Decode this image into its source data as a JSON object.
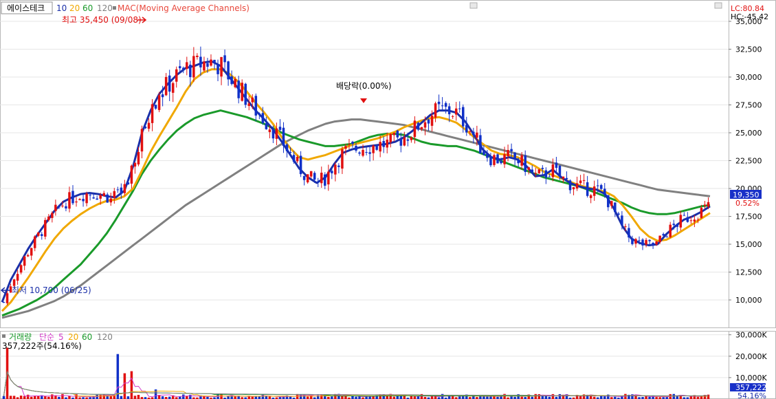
{
  "header": {
    "stock_name": "에이스테크",
    "ma_periods": [
      "10",
      "20",
      "60",
      "120"
    ],
    "indicator_label": "MAC(Moving Average Channels)",
    "indicator_color": "#e8483c",
    "lc_label": "LC:80.84",
    "hc_label": "HC:-45.42"
  },
  "volume_header": {
    "title": "거래량",
    "ma_label": "단순",
    "ma_periods": [
      "5",
      "20",
      "60",
      "120"
    ],
    "current_value": "357,222주(54.16%)"
  },
  "colors": {
    "up": "#e11010",
    "down": "#1030c8",
    "ma10": "#1a2fa8",
    "ma20": "#f0a800",
    "ma60": "#1a9a2a",
    "ma120": "#808080",
    "price_tag": "#1830c8",
    "pct_text": "#e11010",
    "vol_ma5": "#d23cc8",
    "vol_ma20": "#f0a800",
    "vol_ma60": "#1a9a2a",
    "vol_ma120": "#808080"
  },
  "price_panel": {
    "y_ticks": [
      "35,000",
      "32,500",
      "30,000",
      "27,500",
      "25,000",
      "22,500",
      "20,000",
      "17,500",
      "15,000",
      "12,500",
      "10,000"
    ],
    "current_price": "19,350",
    "change_pct": "0.52%"
  },
  "volume_panel": {
    "y_ticks": [
      "30,000K",
      "20,000K",
      "10,000K"
    ],
    "current_volume": "357,222",
    "volume_pct": "54.16%"
  },
  "annotations": {
    "high_label": "최고 35,450 (09/08)",
    "low_label": "최저 10,700 (06/25)",
    "dividend_label": "배당락(0.00%)"
  },
  "chart_data": {
    "type": "candlestick",
    "ylim": [
      8400,
      36800
    ],
    "volume_ylim": [
      0,
      31500000
    ],
    "series": [
      {
        "name": "10",
        "values": [
          9800,
          11800,
          13200,
          14600,
          15800,
          16900,
          18000,
          18800,
          19200,
          19500,
          19600,
          19500,
          19300,
          19200,
          19800,
          22000,
          25000,
          27000,
          28500,
          29400,
          30200,
          30800,
          31000,
          31300,
          31400,
          31000,
          30000,
          29000,
          28000,
          27000,
          26200,
          25300,
          24200,
          23000,
          21800,
          21000,
          20500,
          21000,
          22200,
          23200,
          23500,
          23700,
          23800,
          23900,
          24000,
          24200,
          24600,
          25200,
          25900,
          26600,
          27000,
          27000,
          26800,
          26000,
          24800,
          23500,
          22800,
          22600,
          22800,
          22600,
          22000,
          21100,
          21200,
          21700,
          21000,
          20500,
          20200,
          20000,
          19900,
          19500,
          18200,
          16600,
          15500,
          15100,
          14900,
          15000,
          15900,
          16600,
          17200,
          17500,
          17900,
          18400
        ]
      },
      {
        "name": "20",
        "values": [
          9000,
          9800,
          10900,
          12000,
          13200,
          14400,
          15500,
          16400,
          17100,
          17700,
          18200,
          18600,
          18900,
          19000,
          19300,
          20000,
          21600,
          23300,
          24700,
          26000,
          27300,
          28700,
          29800,
          30400,
          30700,
          30700,
          30300,
          29600,
          28700,
          27700,
          26800,
          25800,
          24600,
          23600,
          22800,
          22600,
          22800,
          23000,
          23300,
          23600,
          23900,
          24100,
          24300,
          24500,
          24800,
          25100,
          25500,
          25800,
          26100,
          26300,
          26400,
          26200,
          25900,
          25300,
          24600,
          24000,
          23400,
          23100,
          23000,
          22800,
          22400,
          22000,
          21500,
          21200,
          20900,
          20600,
          20300,
          20100,
          19900,
          19700,
          19300,
          18500,
          17500,
          16400,
          15700,
          15300,
          15400,
          15800,
          16300,
          16800,
          17300,
          17800
        ]
      },
      {
        "name": "60",
        "values": [
          8600,
          8900,
          9200,
          9600,
          10000,
          10500,
          11100,
          11800,
          12500,
          13200,
          14100,
          15000,
          16000,
          17200,
          18500,
          19800,
          21300,
          22500,
          23500,
          24400,
          25200,
          25800,
          26300,
          26600,
          26800,
          27000,
          26800,
          26600,
          26400,
          26100,
          25800,
          25400,
          25000,
          24700,
          24400,
          24200,
          24000,
          23800,
          23800,
          23900,
          24000,
          24300,
          24600,
          24800,
          24900,
          24900,
          24800,
          24500,
          24200,
          24000,
          23900,
          23800,
          23800,
          23600,
          23400,
          23100,
          22800,
          22500,
          22200,
          21900,
          21600,
          21300,
          21000,
          20800,
          20600,
          20400,
          20200,
          19900,
          19600,
          19300,
          19000,
          18700,
          18300,
          18000,
          17800,
          17700,
          17700,
          17800,
          18000,
          18200,
          18400,
          18500
        ]
      },
      {
        "name": "120",
        "values": [
          8400,
          8600,
          8800,
          9000,
          9300,
          9600,
          9900,
          10300,
          10800,
          11300,
          11900,
          12500,
          13100,
          13700,
          14300,
          14900,
          15500,
          16100,
          16700,
          17300,
          17900,
          18500,
          19000,
          19500,
          20000,
          20500,
          21000,
          21500,
          22000,
          22500,
          23000,
          23500,
          24000,
          24400,
          24800,
          25200,
          25500,
          25800,
          26000,
          26100,
          26200,
          26200,
          26100,
          26000,
          25900,
          25800,
          25700,
          25500,
          25300,
          25100,
          24900,
          24700,
          24500,
          24300,
          24100,
          23900,
          23700,
          23500,
          23300,
          23100,
          22900,
          22700,
          22500,
          22300,
          22100,
          21900,
          21700,
          21500,
          21300,
          21100,
          20900,
          20700,
          20500,
          20300,
          20100,
          19900,
          19800,
          19700,
          19600,
          19500,
          19400,
          19300
        ]
      }
    ]
  }
}
